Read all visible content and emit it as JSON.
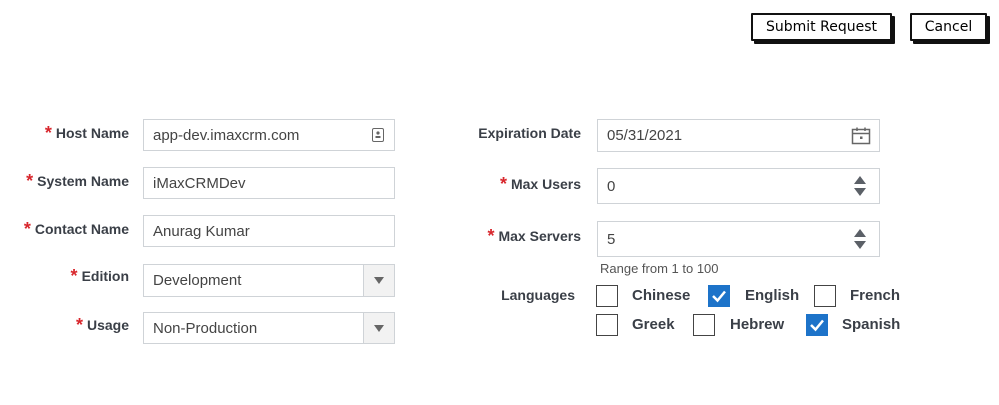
{
  "toolbar": {
    "submit_label": "Submit Request",
    "cancel_label": "Cancel"
  },
  "form": {
    "host_name": {
      "label": "Host Name",
      "value": "app-dev.imaxcrm.com",
      "required": true
    },
    "system_name": {
      "label": "System Name",
      "value": "iMaxCRMDev",
      "required": true
    },
    "contact_name": {
      "label": "Contact Name",
      "value": "Anurag Kumar",
      "required": true
    },
    "edition": {
      "label": "Edition",
      "value": "Development",
      "required": true
    },
    "usage": {
      "label": "Usage",
      "value": "Non-Production",
      "required": true
    },
    "expiration_date": {
      "label": "Expiration Date",
      "value": "05/31/2021"
    },
    "max_users": {
      "label": "Max Users",
      "value": "0",
      "required": true
    },
    "max_servers": {
      "label": "Max Servers",
      "value": "5",
      "required": true,
      "hint": "Range from 1 to 100"
    },
    "languages": {
      "label": "Languages",
      "options": [
        {
          "name": "Chinese",
          "checked": false
        },
        {
          "name": "English",
          "checked": true
        },
        {
          "name": "French",
          "checked": false
        },
        {
          "name": "Greek",
          "checked": false
        },
        {
          "name": "Hebrew",
          "checked": false
        },
        {
          "name": "Spanish",
          "checked": true
        }
      ]
    },
    "required_marker": "*"
  },
  "colors": {
    "required": "#d8262c",
    "checkbox_checked": "#1d73c9",
    "label": "#3a3f47"
  },
  "icons": {
    "host_field": "contact-card-icon",
    "date_field": "calendar-icon"
  }
}
